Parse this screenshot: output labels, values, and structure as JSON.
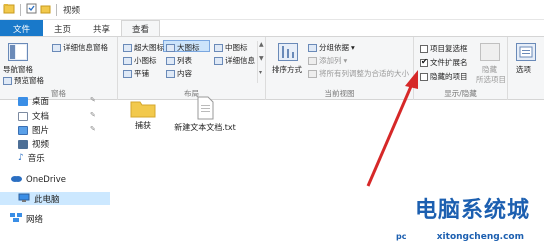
{
  "window": {
    "title": "视频"
  },
  "tabs": [
    {
      "label": "文件"
    },
    {
      "label": "主页"
    },
    {
      "label": "共享"
    },
    {
      "label": "查看"
    }
  ],
  "ribbon": {
    "panes": {
      "label": "窗格",
      "nav_pane": "导航窗格",
      "preview_pane": "预览窗格",
      "details_pane": "详细信息窗格"
    },
    "layout": {
      "label": "布局",
      "items": [
        "超大图标",
        "大图标",
        "中图标",
        "小图标",
        "列表",
        "详细信息",
        "平铺",
        "内容"
      ]
    },
    "current_view": {
      "label": "当前视图",
      "sort_by": "排序方式",
      "group_by": "分组依据",
      "add_columns": "添加列",
      "size_all_columns": "将所有列调整为合适的大小"
    },
    "show_hide": {
      "label": "显示/隐藏",
      "item_checkboxes": "项目复选框",
      "file_extensions": "文件扩展名",
      "hidden_items": "隐藏的项目",
      "hide_selected": "隐藏",
      "hide_selected2": "所选项目"
    },
    "options": {
      "label": "选项"
    }
  },
  "nav": {
    "items": [
      {
        "label": "桌面",
        "pinned": true
      },
      {
        "label": "文档",
        "pinned": true
      },
      {
        "label": "图片",
        "pinned": true
      },
      {
        "label": "视频",
        "pinned": false
      },
      {
        "label": "音乐",
        "pinned": false
      },
      {
        "label": "OneDrive",
        "pinned": false
      },
      {
        "label": "此电脑",
        "pinned": false
      },
      {
        "label": "网络",
        "pinned": false
      }
    ]
  },
  "files": [
    {
      "name": "捕获",
      "type": "folder"
    },
    {
      "name": "新建文本文档.txt",
      "type": "text"
    }
  ],
  "watermark": {
    "title": "电脑系统城",
    "url": "xitongcheng.com",
    "pc": "pc"
  },
  "colors": {
    "accent": "#1979ca",
    "arrow": "#d62828",
    "selected": "#cce8ff",
    "watermark": "#1c5fb0"
  }
}
